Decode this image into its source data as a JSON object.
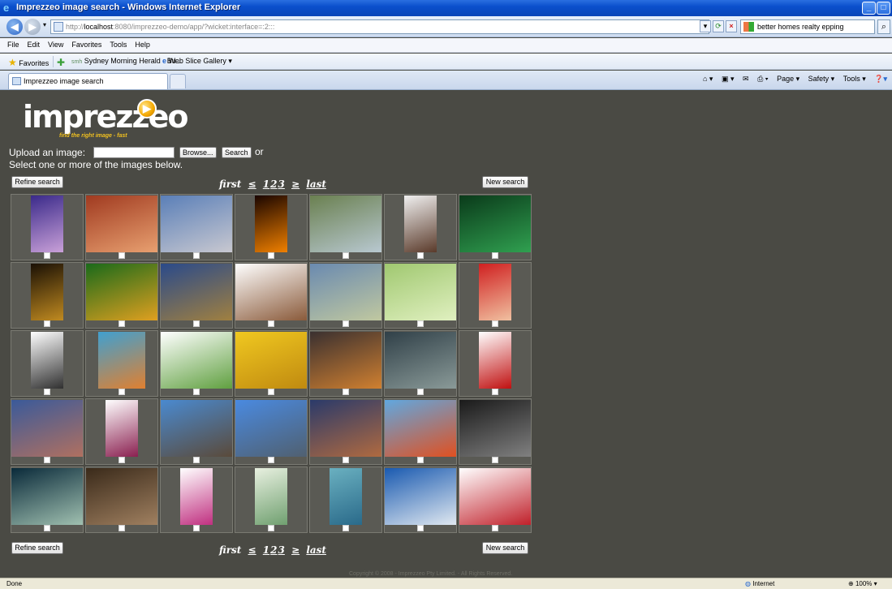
{
  "window": {
    "title": "Imprezzeo image search - Windows Internet Explorer",
    "minimize": "_",
    "maximize": "□",
    "close": "×"
  },
  "address": {
    "prefix": "http://",
    "host": "localhost",
    "rest": ":8080/imprezzeo-demo/app/?wicket:interface=:2:::",
    "search_text": "better homes realty epping"
  },
  "menu": [
    "File",
    "Edit",
    "View",
    "Favorites",
    "Tools",
    "Help"
  ],
  "favorites": {
    "label": "Favorites",
    "link1": "Sydney Morning Herald - Bu...",
    "link2": "Web Slice Gallery ▾"
  },
  "tab": {
    "title": "Imprezzeo image search"
  },
  "commands": [
    "Page ▾",
    "Safety ▾",
    "Tools ▾"
  ],
  "logo": {
    "word": "imprezzeo",
    "tagline": "find the right image - fast"
  },
  "upload": {
    "label": "Upload an image:",
    "browse": "Browse...",
    "search": "Search",
    "or": "or",
    "instruction": "Select one or more of the images below."
  },
  "controls": {
    "refine": "Refine search",
    "new_search": "New search",
    "first": "first",
    "prev": "≤",
    "pages": [
      "1",
      "2",
      "3"
    ],
    "next": "≥",
    "last": "last"
  },
  "images": [
    {
      "name": "hands",
      "shape": "portrait",
      "colors": [
        "#3a2a8a",
        "#c9a0d8"
      ]
    },
    {
      "name": "temple-ceiling",
      "shape": "landscape",
      "colors": [
        "#a03a20",
        "#e8a070"
      ]
    },
    {
      "name": "skyscraper",
      "shape": "landscape",
      "colors": [
        "#5a7fb8",
        "#c8c8d0"
      ]
    },
    {
      "name": "sunset-sea",
      "shape": "portrait",
      "colors": [
        "#1a0500",
        "#f08000"
      ]
    },
    {
      "name": "elephants",
      "shape": "landscape",
      "colors": [
        "#6a8050",
        "#b8c8d0"
      ]
    },
    {
      "name": "man-with-bag",
      "shape": "portrait",
      "colors": [
        "#f0f0f0",
        "#5a3a2a"
      ]
    },
    {
      "name": "green-corridor",
      "shape": "landscape",
      "colors": [
        "#0a3a1a",
        "#30a050"
      ]
    },
    {
      "name": "fireworks",
      "shape": "portrait",
      "colors": [
        "#1a1005",
        "#c08a20"
      ]
    },
    {
      "name": "green-peppers",
      "shape": "landscape",
      "colors": [
        "#1a6a1a",
        "#e0a020"
      ]
    },
    {
      "name": "mountain-plain",
      "shape": "landscape",
      "colors": [
        "#2a4a8a",
        "#a08040"
      ]
    },
    {
      "name": "butterfly",
      "shape": "landscape",
      "colors": [
        "#ffffff",
        "#8a5a3a"
      ]
    },
    {
      "name": "lake-statue",
      "shape": "landscape",
      "colors": [
        "#6a8ab0",
        "#c0c8a0"
      ]
    },
    {
      "name": "cabbage",
      "shape": "landscape",
      "colors": [
        "#a0c870",
        "#e0f0c0"
      ]
    },
    {
      "name": "crying-baby",
      "shape": "portrait",
      "colors": [
        "#d02020",
        "#f0c0a0"
      ]
    },
    {
      "name": "businessman",
      "shape": "portrait",
      "colors": [
        "#ffffff",
        "#303030"
      ]
    },
    {
      "name": "kids-circle",
      "shape": "square",
      "colors": [
        "#40a0d0",
        "#e08030"
      ]
    },
    {
      "name": "vegetables",
      "shape": "landscape",
      "colors": [
        "#ffffff",
        "#60a040"
      ]
    },
    {
      "name": "bananas",
      "shape": "landscape",
      "colors": [
        "#f0c820",
        "#c08a10"
      ]
    },
    {
      "name": "tigers-snow",
      "shape": "landscape",
      "colors": [
        "#3a3030",
        "#d08030"
      ]
    },
    {
      "name": "misty-bay",
      "shape": "landscape",
      "colors": [
        "#304048",
        "#8a9a98"
      ]
    },
    {
      "name": "cherries",
      "shape": "portrait",
      "colors": [
        "#ffffff",
        "#c01010"
      ]
    },
    {
      "name": "dusk-clouds",
      "shape": "landscape",
      "colors": [
        "#3a5a9a",
        "#b07060"
      ]
    },
    {
      "name": "red-onion",
      "shape": "portrait",
      "colors": [
        "#ffffff",
        "#8a2050"
      ]
    },
    {
      "name": "roof-sky",
      "shape": "landscape",
      "colors": [
        "#4a8ad0",
        "#5a4a3a"
      ]
    },
    {
      "name": "city-skyline",
      "shape": "landscape",
      "colors": [
        "#4a8ae0",
        "#506070"
      ]
    },
    {
      "name": "coral",
      "shape": "landscape",
      "colors": [
        "#2a3a6a",
        "#b06a40"
      ]
    },
    {
      "name": "masked-face",
      "shape": "landscape",
      "colors": [
        "#60a8e0",
        "#e05020"
      ]
    },
    {
      "name": "gorilla",
      "shape": "landscape",
      "colors": [
        "#1a1a1a",
        "#808080"
      ]
    },
    {
      "name": "barracuda",
      "shape": "landscape",
      "colors": [
        "#0a2a3a",
        "#a0c0b0"
      ]
    },
    {
      "name": "dry-grass",
      "shape": "landscape",
      "colors": [
        "#3a2a1a",
        "#a08060"
      ]
    },
    {
      "name": "clown",
      "shape": "portrait",
      "colors": [
        "#ffffff",
        "#c03080"
      ]
    },
    {
      "name": "watercolor-tree",
      "shape": "portrait",
      "colors": [
        "#e8f0e0",
        "#70a070"
      ]
    },
    {
      "name": "nurse",
      "shape": "portrait",
      "colors": [
        "#6ab0c0",
        "#2a6a8a"
      ]
    },
    {
      "name": "snowy-branch",
      "shape": "landscape",
      "colors": [
        "#1a5ab0",
        "#e0e8f0"
      ]
    },
    {
      "name": "woman-portrait",
      "shape": "landscape",
      "colors": [
        "#ffffff",
        "#c0202a"
      ]
    }
  ],
  "copyright": "Copyright © 2008 - Imprezzeo Pty Limited. - All Rights Reserved.",
  "status": {
    "left": "Done",
    "zone": "Internet",
    "zoom": "100%"
  }
}
